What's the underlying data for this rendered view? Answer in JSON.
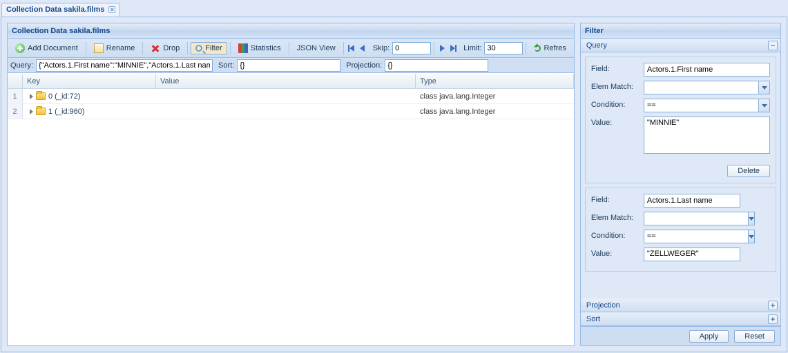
{
  "tab_title": "Collection Data sakila.films",
  "panel_title": "Collection Data sakila.films",
  "toolbar": {
    "add_document": "Add Document",
    "rename": "Rename",
    "drop": "Drop",
    "filter": "Filter",
    "statistics": "Statistics",
    "json_view": "JSON View",
    "skip_label": "Skip:",
    "skip_value": "0",
    "limit_label": "Limit:",
    "limit_value": "30",
    "refresh": "Refres"
  },
  "query_bar": {
    "query_label": "Query:",
    "query_value": "{\"Actors.1.First name\":\"MINNIE\",\"Actors.1.Last nam",
    "sort_label": "Sort:",
    "sort_value": "{}",
    "projection_label": "Projection:",
    "projection_value": "{}"
  },
  "grid": {
    "headers": {
      "key": "Key",
      "value": "Value",
      "type": "Type"
    },
    "rows": [
      {
        "n": "1",
        "key": "0 (_id:72)",
        "value": "",
        "type": "class java.lang.Integer"
      },
      {
        "n": "2",
        "key": "1 (_id:960)",
        "value": "",
        "type": "class java.lang.Integer"
      }
    ]
  },
  "filter_panel": {
    "title": "Filter",
    "query_section": "Query",
    "projection_section": "Projection",
    "sort_section": "Sort",
    "labels": {
      "field": "Field:",
      "elem_match": "Elem Match:",
      "condition": "Condition:",
      "value": "Value:"
    },
    "delete_btn": "Delete",
    "apply_btn": "Apply",
    "reset_btn": "Reset",
    "groups": [
      {
        "field": "Actors.1.First name",
        "elem_match": "",
        "condition": "==",
        "value": "\"MINNIE\""
      },
      {
        "field": "Actors.1.Last name",
        "elem_match": "",
        "condition": "==",
        "value": "\"ZELLWEGER\""
      }
    ]
  }
}
